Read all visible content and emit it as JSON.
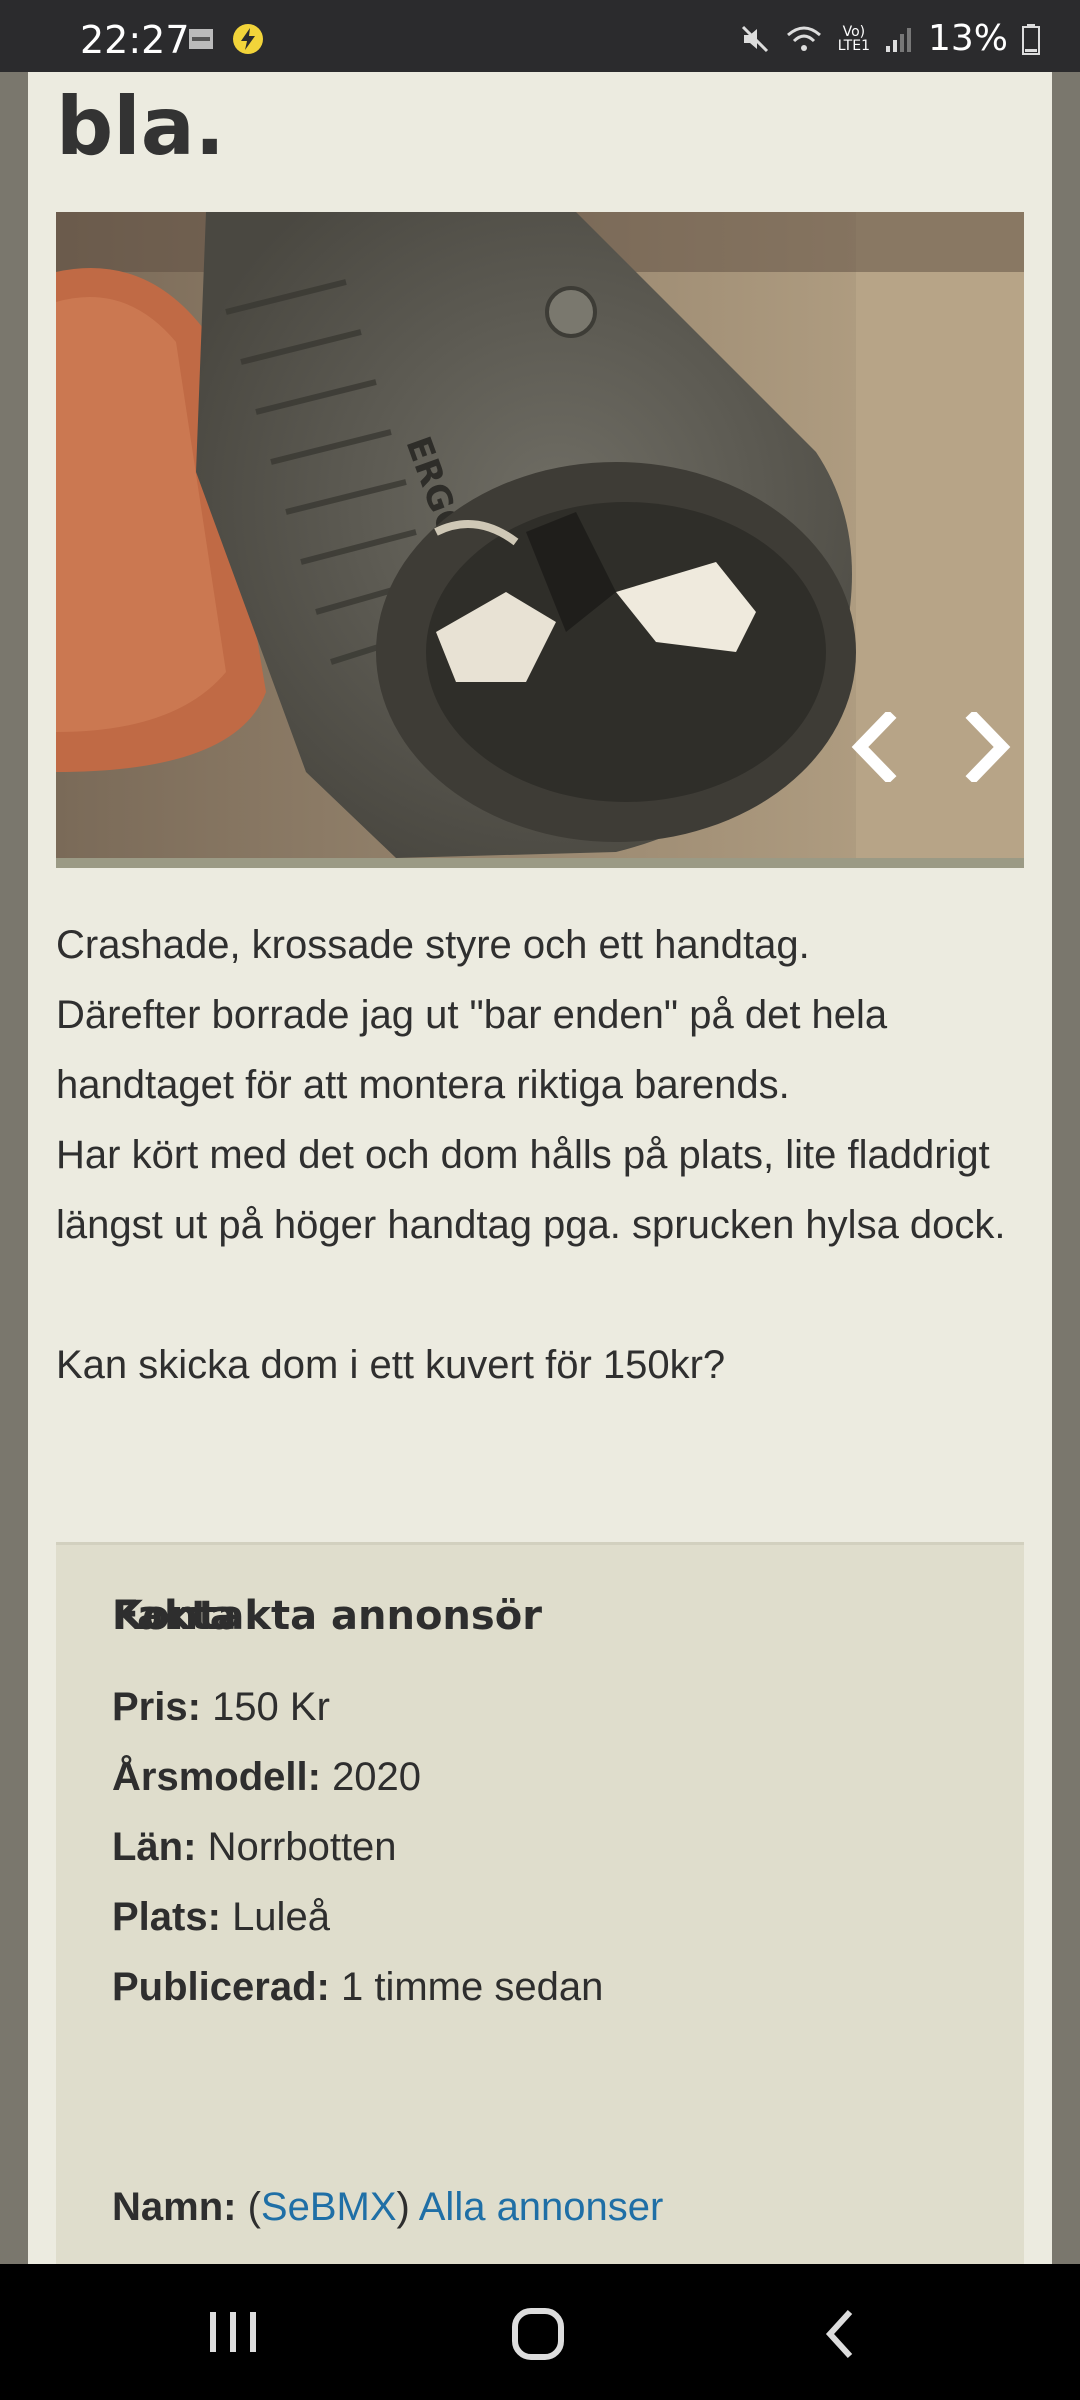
{
  "status_bar": {
    "time": "22:27",
    "battery": "13%",
    "network": "LTE1"
  },
  "listing": {
    "title_tail": "bla.",
    "description": "Crashade, krossade styre och ett handtag.\nDärefter borrade jag ut \"bar enden\" på det hela handtaget för att montera riktiga barends.\nHar kört med det och dom hålls på plats, lite fladdrigt längst ut på höger handtag pga. sprucken hylsa dock.\n\nKan skicka dom i ett kuvert för 150kr?",
    "photo_brand_text": "ERGON"
  },
  "facts": {
    "heading": "Fakta",
    "price_label": "Pris:",
    "price": "150 Kr",
    "year_label": "Årsmodell:",
    "year": "2020",
    "county_label": "Län:",
    "county": "Norrbotten",
    "place_label": "Plats:",
    "place": "Luleå",
    "published_label": "Publicerad:",
    "published": "1 timme sedan"
  },
  "contact": {
    "heading": "Kontakta annonsör",
    "name_label": "Namn:",
    "open_paren": "(",
    "username": "SeBMX",
    "close_paren": ")",
    "all_ads_link": "Alla annonser"
  },
  "colors": {
    "page_bg": "#ecebe0",
    "facts_bg": "#dfddcc",
    "link": "#1f6fa6",
    "frame": "#7a776d"
  }
}
